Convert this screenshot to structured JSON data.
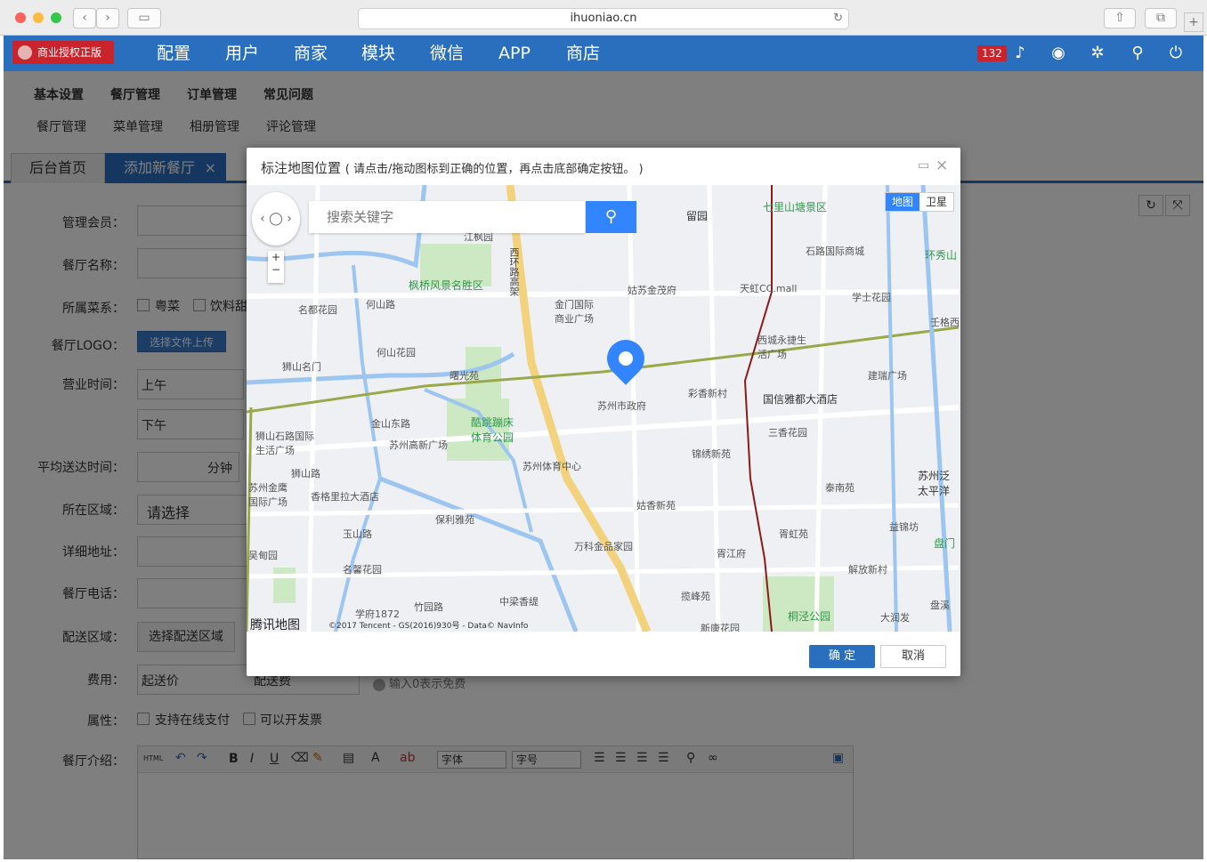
{
  "browser": {
    "url": "ihuoniao.cn"
  },
  "header": {
    "license": "商业授权正版",
    "nav": [
      "配置",
      "用户",
      "商家",
      "模块",
      "微信",
      "APP",
      "商店"
    ],
    "badge": "132"
  },
  "subnav": {
    "level1": [
      "基本设置",
      "餐厅管理",
      "订单管理",
      "常见问题"
    ],
    "level2": [
      "餐厅管理",
      "菜单管理",
      "相册管理",
      "评论管理"
    ]
  },
  "tabs": [
    "后台首页",
    "添加新餐厅"
  ],
  "form": {
    "member": "管理会员：",
    "name": "餐厅名称：",
    "cuisine": "所属菜系：",
    "cuisine_opts": [
      "粤菜",
      "饮料甜"
    ],
    "logo": "餐厅LOGO：",
    "upload": "选择文件上传",
    "hours": "营业时间：",
    "am": "上午",
    "pm": "下午",
    "avg": "平均送达时间：",
    "minute": "分钟",
    "area": "所在区域：",
    "area_select": "请选择",
    "address": "详细地址：",
    "phone": "餐厅电话：",
    "delivery": "配送区域：",
    "delivery_btn": "选择配送区域",
    "fee": "费用：",
    "fee_start": "起送价",
    "fee_ship": "配送费",
    "fee_hint": "输入0表示免费",
    "attr": "属性：",
    "attr_opts": [
      "支持在线支付",
      "可以开发票"
    ],
    "intro": "餐厅介绍："
  },
  "editor": {
    "font": "字体",
    "size": "字号",
    "html": "HTML"
  },
  "modal": {
    "title": "标注地图位置",
    "hint": "( 请点击/拖动图标到正确的位置，再点击底部确定按钮。 )",
    "search_placeholder": "搜索关键字",
    "map_type": [
      "地图",
      "卫星"
    ],
    "confirm": "确 定",
    "cancel": "取消",
    "brand": "腾讯地图",
    "copyright": "©2017 Tencent - GS(2016)930号 - Data© NavInfo",
    "marker_label": "苏州市政府",
    "labels": [
      "江枫园",
      "留园",
      "七里山塘景区",
      "石路国际商城",
      "环秀山",
      "枫桥风景名胜区",
      "西环路高架",
      "金门国际商业广场",
      "姑苏金茂府",
      "天虹CC.mall",
      "学士花园",
      "名都花园",
      "何山路",
      "西城永捷生活广场",
      "狮山名门",
      "何山花园",
      "曙光苑",
      "彩香新村",
      "建瑞广场",
      "国信雅都大酒店",
      "金山东路",
      "酷跳蹦床体育公园",
      "三香花园",
      "狮山石路国际生活广场",
      "苏州高新广场",
      "锦绣新苑",
      "苏州体育中心",
      "狮山路",
      "泰南苑",
      "苏州金鹰国际广场",
      "香格里拉大酒店",
      "姑香新苑",
      "保利雅苑",
      "玉山路",
      "胥虹苑",
      "万科金品家园",
      "益锦坊",
      "吴甸园",
      "名馨花园",
      "胥江府",
      "解放新村",
      "中梁香缇",
      "学府1872",
      "竹园路",
      "揽峰苑",
      "桐泾公园",
      "大润发",
      "新康花园",
      "盘溪",
      "盘门",
      "苏州泛太平洋",
      "壬格西"
    ]
  }
}
